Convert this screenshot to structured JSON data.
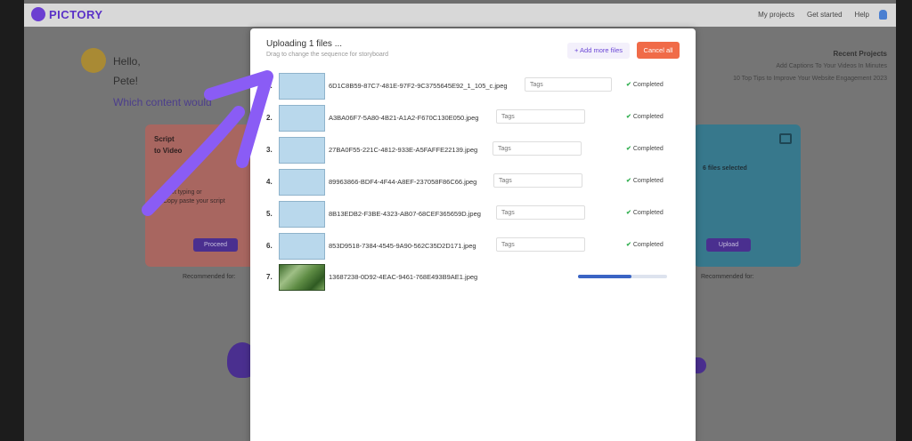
{
  "nav": {
    "logo_text": "PICTORY",
    "links": [
      "My projects",
      "Get started",
      "Help"
    ]
  },
  "background": {
    "hello": "Hello,",
    "name": "Pete!",
    "question": "Which content would",
    "recent_title": "Recent Projects",
    "recent_items": [
      "Add Captions To Your Videos In Minutes",
      "10 Top Tips to Improve Your Website Engagement 2023"
    ],
    "script_card": {
      "title_line1": "Script",
      "title_line2": "to Video",
      "desc_line1": "Start typing or",
      "desc_line2": "Copy paste your script",
      "button": "Proceed"
    },
    "visuals_card": {
      "selected": "6 files selected",
      "button": "Upload"
    },
    "recommended_left": "Recommended for:",
    "recommended_right": "Recommended for:"
  },
  "modal": {
    "title": "Uploading 1 files ...",
    "subtitle": "Drag to change the sequence for storyboard",
    "add_more": "+ Add more files",
    "cancel_all": "Cancel all",
    "tags_placeholder": "Tags",
    "completed_label": "Completed",
    "files": [
      {
        "num": "1.",
        "name": "6D1C8B59-87C7-481E-97F2-9C3755645E92_1_105_c.jpeg",
        "status": "completed",
        "thumb": "blue"
      },
      {
        "num": "2.",
        "name": "A3BA06F7-5A80-4B21-A1A2-F670C130E050.jpeg",
        "status": "completed",
        "thumb": "blue"
      },
      {
        "num": "3.",
        "name": "27BA0F55-221C-4812-933E-A5FAFFE22139.jpeg",
        "status": "completed",
        "thumb": "blue"
      },
      {
        "num": "4.",
        "name": "89963866-BDF4-4F44-A8EF-237058F86C66.jpeg",
        "status": "completed",
        "thumb": "blue"
      },
      {
        "num": "5.",
        "name": "8B13EDB2-F3BE-4323-AB07-68CEF365659D.jpeg",
        "status": "completed",
        "thumb": "blue"
      },
      {
        "num": "6.",
        "name": "853D9518-7384-4545-9A90-562C35D2D171.jpeg",
        "status": "completed",
        "thumb": "blue"
      },
      {
        "num": "7.",
        "name": "13687238-0D92-4EAC-9461-768E493B9AE1.jpeg",
        "status": "uploading",
        "thumb": "photo",
        "progress": 0.6
      }
    ]
  },
  "colors": {
    "accent": "#6b47d6",
    "cancel": "#f06b48",
    "success": "#2fae4e",
    "progress": "#3a64c4",
    "annotation": "#8a5cf5"
  }
}
